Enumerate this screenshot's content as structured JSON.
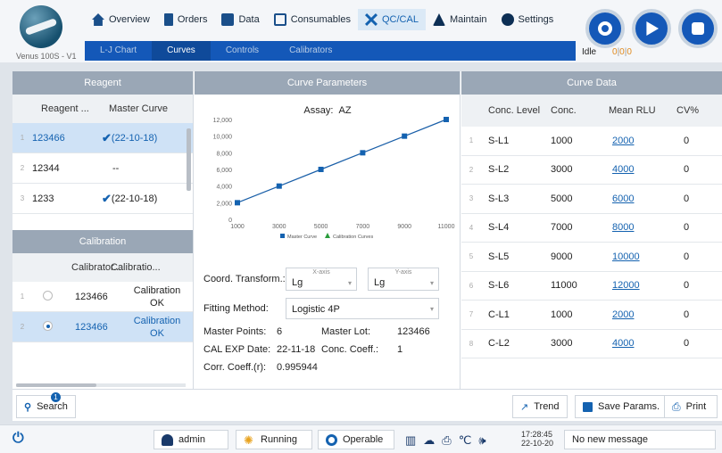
{
  "app": {
    "version": "Venus 100S - V1"
  },
  "nav": [
    {
      "label": "Overview",
      "icon": "home-icon"
    },
    {
      "label": "Orders",
      "icon": "orders-icon"
    },
    {
      "label": "Data",
      "icon": "data-icon"
    },
    {
      "label": "Consumables",
      "icon": "consumables-icon"
    },
    {
      "label": "QC/CAL",
      "icon": "qc-cal-icon",
      "active": true
    },
    {
      "label": "Maintain",
      "icon": "maintain-icon"
    },
    {
      "label": "Settings",
      "icon": "settings-icon"
    }
  ],
  "subtabs": [
    {
      "label": "L-J Chart"
    },
    {
      "label": "Curves",
      "active": true
    },
    {
      "label": "Controls"
    },
    {
      "label": "Calibrators"
    }
  ],
  "status": {
    "state": "Idle",
    "count_a": "0",
    "sep1": "|",
    "count_b": "0",
    "sep2": "|",
    "count_c": "0"
  },
  "reagent": {
    "title": "Reagent",
    "columns": [
      "Reagent ...",
      "Master Curve"
    ],
    "rows": [
      {
        "index": "1",
        "name": "123466",
        "curve": "(22-10-18)",
        "checked": true,
        "selected": true
      },
      {
        "index": "2",
        "name": "12344",
        "curve": "--",
        "checked": false
      },
      {
        "index": "3",
        "name": "1233",
        "curve": "(22-10-18)",
        "checked": true
      }
    ]
  },
  "calibration": {
    "title": "Calibration",
    "columns": [
      "Calibrator...",
      "Calibratio..."
    ],
    "rows": [
      {
        "index": "1",
        "calibrator": "123466",
        "status_line1": "Calibration",
        "status_line2": "OK",
        "selected": false
      },
      {
        "index": "2",
        "calibrator": "123466",
        "status_line1": "Calibration",
        "status_line2": "OK",
        "selected": true
      }
    ]
  },
  "curve_params": {
    "title": "Curve Parameters",
    "assay_label": "Assay:",
    "assay_value": "AZ",
    "coord_label": "Coord. Transform.:",
    "xaxis_label": "X-axis",
    "xaxis_value": "Lg",
    "yaxis_label": "Y-axis",
    "yaxis_value": "Lg",
    "fitting_label": "Fitting Method:",
    "fitting_value": "Logistic 4P",
    "master_points_label": "Master Points:",
    "master_points_value": "6",
    "master_lot_label": "Master Lot:",
    "master_lot_value": "123466",
    "cal_exp_label": "CAL EXP Date:",
    "cal_exp_value": "22-11-18",
    "conc_coeff_label": "Conc. Coeff.:",
    "conc_coeff_value": "1",
    "corr_label": "Corr. Coeff.(r):",
    "corr_value": "0.995944"
  },
  "chart_data": {
    "type": "line",
    "x": [
      1000,
      3000,
      5000,
      7000,
      9000,
      11000
    ],
    "series": [
      {
        "name": "Master Curve",
        "values": [
          2000,
          4000,
          6000,
          8000,
          10000,
          12000
        ],
        "color": "#1462b0"
      },
      {
        "name": "Calibration Curves",
        "values": [
          2000,
          4000,
          6000,
          8000,
          10000,
          12000
        ],
        "color": "#2a9d3c"
      }
    ],
    "xticks": [
      "1000",
      "3000",
      "5000",
      "7000",
      "9000",
      "11000"
    ],
    "yticks": [
      "0",
      "2,000",
      "4,000",
      "6,000",
      "8,000",
      "10,000",
      "12,000"
    ],
    "xlim": [
      1000,
      11000
    ],
    "ylim": [
      0,
      12000
    ],
    "legend": "bottom"
  },
  "curve_data": {
    "title": "Curve Data",
    "columns": [
      "Conc. Level",
      "Conc.",
      "Mean RLU",
      "CV%"
    ],
    "rows": [
      {
        "index": "1",
        "level": "S-L1",
        "conc": "1000",
        "rlu": "2000",
        "cv": "0"
      },
      {
        "index": "2",
        "level": "S-L2",
        "conc": "3000",
        "rlu": "4000",
        "cv": "0"
      },
      {
        "index": "3",
        "level": "S-L3",
        "conc": "5000",
        "rlu": "6000",
        "cv": "0"
      },
      {
        "index": "4",
        "level": "S-L4",
        "conc": "7000",
        "rlu": "8000",
        "cv": "0"
      },
      {
        "index": "5",
        "level": "S-L5",
        "conc": "9000",
        "rlu": "10000",
        "cv": "0"
      },
      {
        "index": "6",
        "level": "S-L6",
        "conc": "11000",
        "rlu": "12000",
        "cv": "0"
      },
      {
        "index": "7",
        "level": "C-L1",
        "conc": "1000",
        "rlu": "2000",
        "cv": "0"
      },
      {
        "index": "8",
        "level": "C-L2",
        "conc": "3000",
        "rlu": "4000",
        "cv": "0"
      }
    ]
  },
  "toolbar": {
    "search_label": "Search",
    "search_badge": "1",
    "trend_label": "Trend",
    "save_label": "Save Params.",
    "print_label": "Print"
  },
  "footer": {
    "user": "admin",
    "running": "Running",
    "operable": "Operable",
    "time": "17:28:45",
    "date": "22-10-20",
    "message": "No new message"
  },
  "colors": {
    "accent": "#1458b8",
    "selected_row": "#cfe2f6",
    "panel_header": "#9aa7b6"
  }
}
